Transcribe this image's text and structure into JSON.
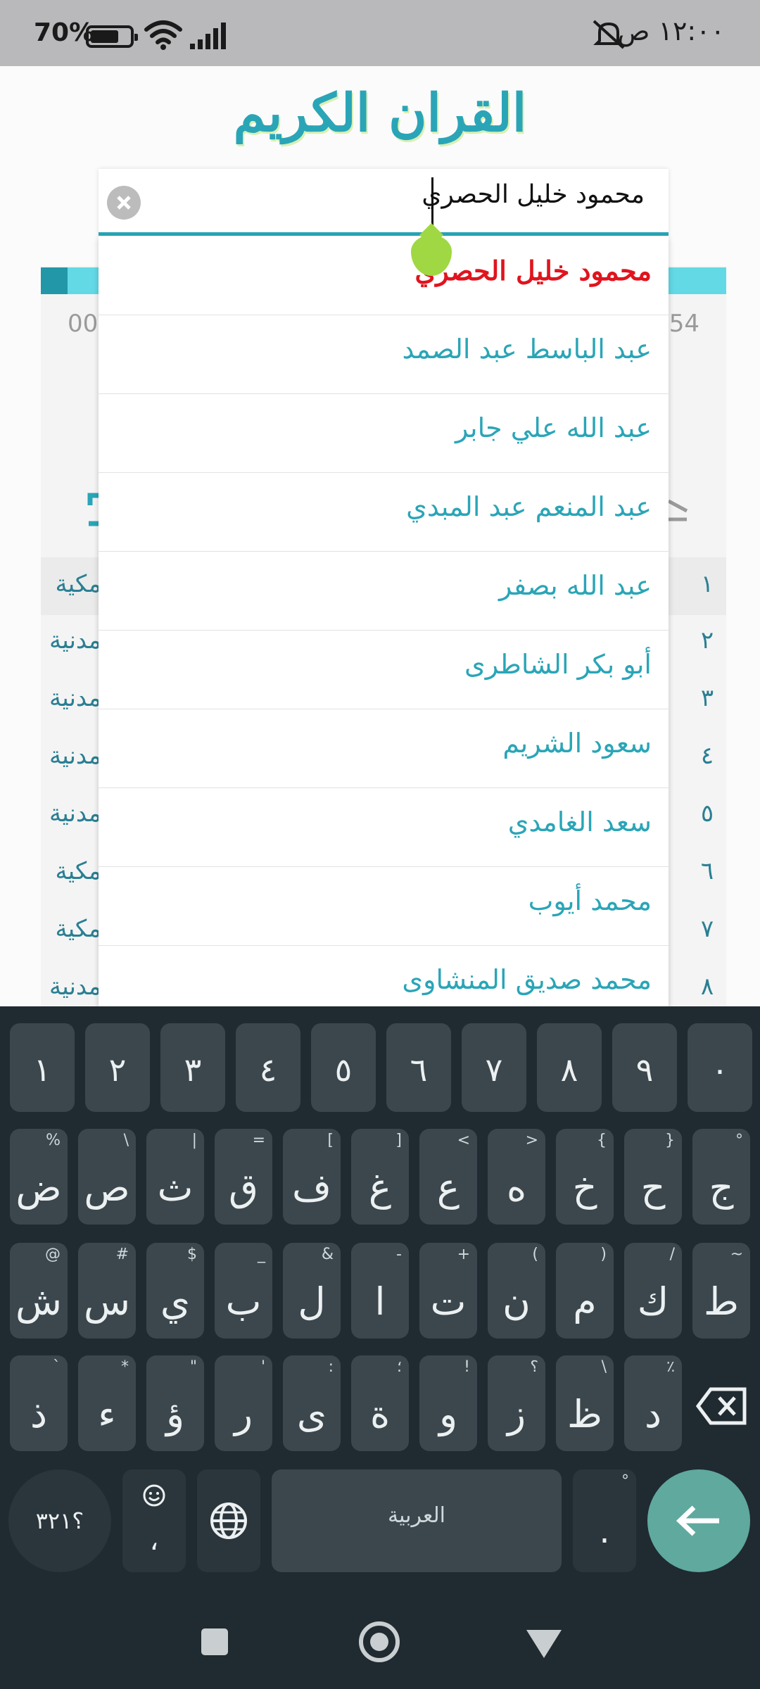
{
  "status_bar": {
    "time": "١٢:٠٠ ص",
    "battery": "70%",
    "battery_level": 0.7
  },
  "app": {
    "title": "القران الكريم",
    "player": {
      "elapsed": "00",
      "total": "54"
    },
    "suras": [
      {
        "num": "١",
        "type": "مكية"
      },
      {
        "num": "٢",
        "type": "مدنية"
      },
      {
        "num": "٣",
        "type": "مدنية"
      },
      {
        "num": "٤",
        "type": "مدنية"
      },
      {
        "num": "٥",
        "type": "مدنية"
      },
      {
        "num": "٦",
        "type": "مكية"
      },
      {
        "num": "٧",
        "type": "مكية"
      },
      {
        "num": "٨",
        "type": "مدنية"
      }
    ]
  },
  "search": {
    "value": "محمود خليل الحصري",
    "suggestions": [
      {
        "label": "محمود خليل الحصري"
      },
      {
        "label": "عبد الباسط عبد الصمد"
      },
      {
        "label": "عبد الله علي جابر"
      },
      {
        "label": "عبد المنعم عبد المبدي"
      },
      {
        "label": "عبد الله بصفر"
      },
      {
        "label": "أبو بكر الشاطرى"
      },
      {
        "label": "سعود الشريم"
      },
      {
        "label": "سعد الغامدي"
      },
      {
        "label": "محمد أيوب"
      },
      {
        "label": "محمد صديق المنشاوى"
      }
    ]
  },
  "keyboard": {
    "numbers": [
      "١",
      "٢",
      "٣",
      "٤",
      "٥",
      "٦",
      "٧",
      "٨",
      "٩",
      "٠"
    ],
    "row1": [
      {
        "c": "ض",
        "h": "%"
      },
      {
        "c": "ص",
        "h": "\\"
      },
      {
        "c": "ث",
        "h": "|"
      },
      {
        "c": "ق",
        "h": "="
      },
      {
        "c": "ف",
        "h": "["
      },
      {
        "c": "غ",
        "h": "]"
      },
      {
        "c": "ع",
        "h": "<"
      },
      {
        "c": "ه",
        "h": ">"
      },
      {
        "c": "خ",
        "h": "{"
      },
      {
        "c": "ح",
        "h": "}"
      },
      {
        "c": "ج",
        "h": "°"
      }
    ],
    "row2": [
      {
        "c": "ش",
        "h": "@"
      },
      {
        "c": "س",
        "h": "#"
      },
      {
        "c": "ي",
        "h": "$"
      },
      {
        "c": "ب",
        "h": "_"
      },
      {
        "c": "ل",
        "h": "&"
      },
      {
        "c": "ا",
        "h": "-"
      },
      {
        "c": "ت",
        "h": "+"
      },
      {
        "c": "ن",
        "h": "("
      },
      {
        "c": "م",
        "h": ")"
      },
      {
        "c": "ك",
        "h": "/"
      },
      {
        "c": "ط",
        "h": "~"
      }
    ],
    "row3": [
      {
        "c": "ذ",
        "h": "`"
      },
      {
        "c": "ء",
        "h": "*"
      },
      {
        "c": "ؤ",
        "h": "\""
      },
      {
        "c": "ر",
        "h": "'"
      },
      {
        "c": "ى",
        "h": ":"
      },
      {
        "c": "ة",
        "h": "؛"
      },
      {
        "c": "و",
        "h": "!"
      },
      {
        "c": "ز",
        "h": "؟"
      },
      {
        "c": "ظ",
        "h": "\\"
      },
      {
        "c": "د",
        "h": "٪"
      }
    ],
    "symbols_label": "؟٣٢١",
    "comma_label": "،",
    "space_label": "العربية",
    "period_label": "."
  },
  "colors": {
    "accent": "#2aa5b7",
    "selected": "#e0141e",
    "keyboard_bg": "#202a31",
    "key_bg": "#3b474d",
    "enter": "#5fa99f"
  }
}
